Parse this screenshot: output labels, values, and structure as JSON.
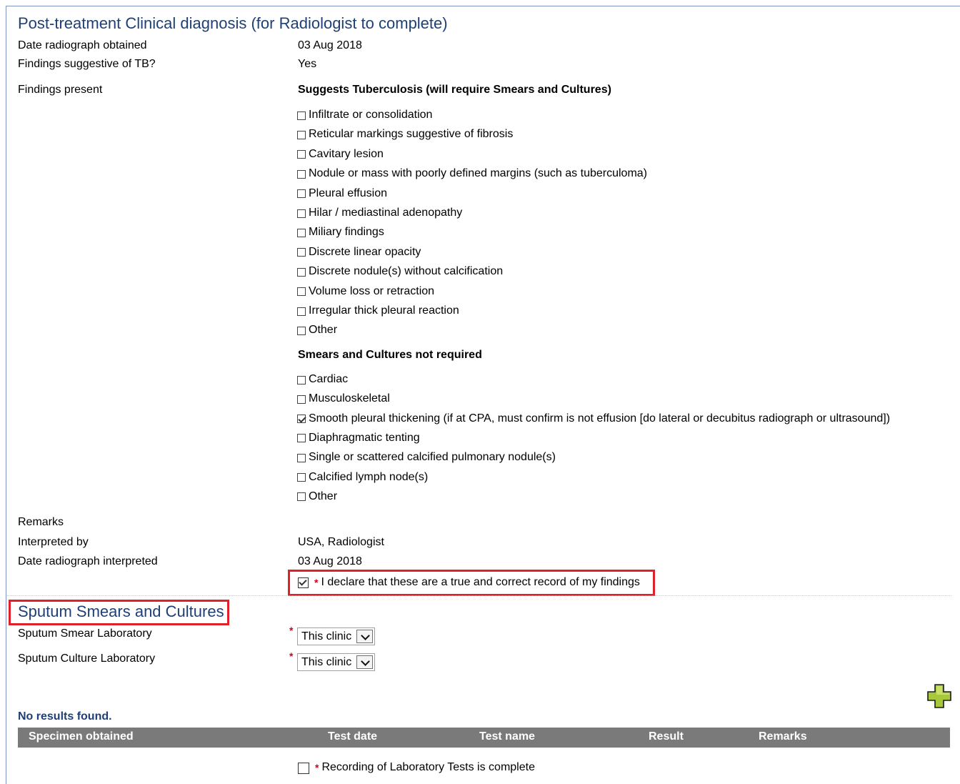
{
  "clinical": {
    "title": "Post-treatment Clinical diagnosis (for Radiologist to complete)",
    "date_obtained_label": "Date radiograph obtained",
    "date_obtained_value": "03 Aug 2018",
    "suggestive_label": "Findings suggestive of TB?",
    "suggestive_value": "Yes",
    "findings_label": "Findings present",
    "group1_title": "Suggests Tuberculosis (will require Smears and Cultures)",
    "group1_items": [
      {
        "label": "Infiltrate or consolidation",
        "checked": false
      },
      {
        "label": "Reticular markings suggestive of fibrosis",
        "checked": false
      },
      {
        "label": "Cavitary lesion",
        "checked": false
      },
      {
        "label": "Nodule or mass with poorly defined margins (such as tuberculoma)",
        "checked": false
      },
      {
        "label": "Pleural effusion",
        "checked": false
      },
      {
        "label": "Hilar / mediastinal adenopathy",
        "checked": false
      },
      {
        "label": "Miliary findings",
        "checked": false
      },
      {
        "label": "Discrete linear opacity",
        "checked": false
      },
      {
        "label": "Discrete nodule(s) without calcification",
        "checked": false
      },
      {
        "label": "Volume loss or retraction",
        "checked": false
      },
      {
        "label": "Irregular thick pleural reaction",
        "checked": false
      },
      {
        "label": "Other",
        "checked": false
      }
    ],
    "group2_title": "Smears and Cultures not required",
    "group2_items": [
      {
        "label": "Cardiac",
        "checked": false
      },
      {
        "label": "Musculoskeletal",
        "checked": false
      },
      {
        "label": "Smooth pleural thickening (if at CPA, must confirm is not effusion [do lateral or decubitus radiograph or ultrasound])",
        "checked": true
      },
      {
        "label": "Diaphragmatic tenting",
        "checked": false
      },
      {
        "label": "Single or scattered calcified pulmonary nodule(s)",
        "checked": false
      },
      {
        "label": "Calcified lymph node(s)",
        "checked": false
      },
      {
        "label": "Other",
        "checked": false
      }
    ],
    "remarks_label": "Remarks",
    "interpreted_by_label": "Interpreted by",
    "interpreted_by_value": "USA, Radiologist",
    "date_interpreted_label": "Date radiograph interpreted",
    "date_interpreted_value": "03 Aug 2018",
    "required_mark": "*",
    "declaration_label": "I declare that these are a true and correct record of my findings",
    "declaration_checked": true
  },
  "sputum": {
    "title": "Sputum Smears and Cultures",
    "smear_lab_label": "Sputum Smear Laboratory",
    "smear_lab_value": "This clinic",
    "culture_lab_label": "Sputum Culture Laboratory",
    "culture_lab_value": "This clinic",
    "add_icon": "green-plus-icon",
    "no_results": "No results found.",
    "columns": [
      "Specimen obtained",
      "Test date",
      "Test name",
      "Result",
      "Remarks"
    ],
    "complete_label": "Recording of Laboratory Tests is complete",
    "complete_checked": false
  },
  "colors": {
    "title_blue": "#1f3f77",
    "highlight_red": "#e0202a",
    "table_header_gray": "#7a7a7a",
    "plus_green": "#a8c83c"
  }
}
